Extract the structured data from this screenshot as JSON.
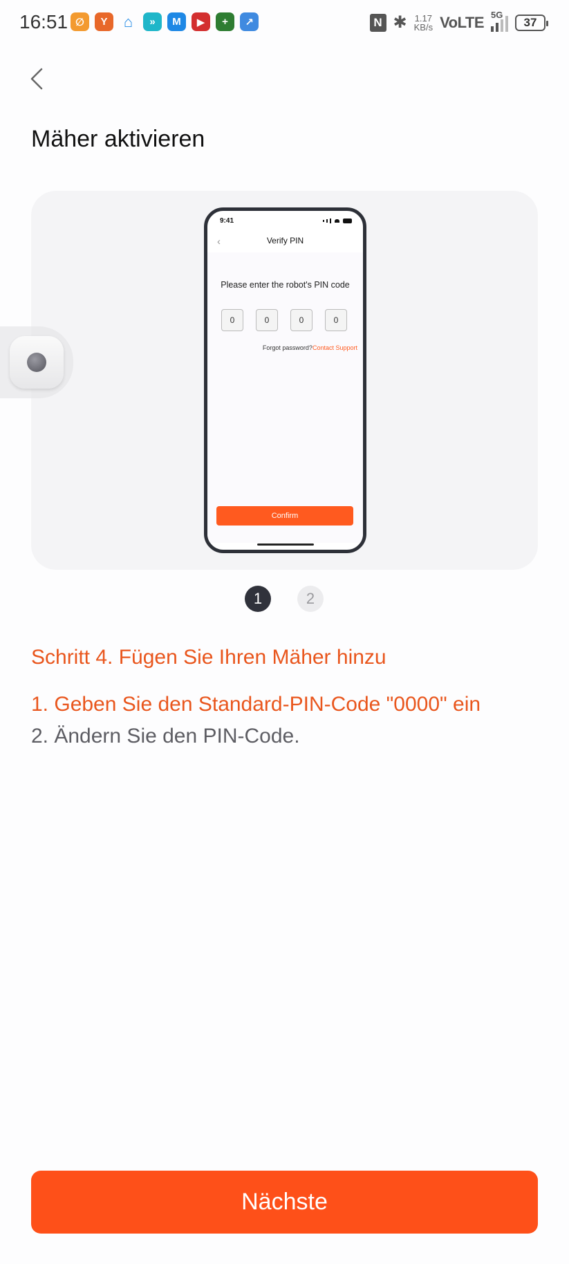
{
  "status_bar": {
    "time": "16:51",
    "speed_value": "1.17",
    "speed_unit": "KB/s",
    "network": "VoLTE",
    "generation": "5G",
    "battery": "37",
    "app_icons": [
      {
        "name": "app-icon-1",
        "color": "#f39a2f"
      },
      {
        "name": "app-icon-2",
        "color": "#e8682a"
      },
      {
        "name": "home-icon",
        "color": "#1e88e5"
      },
      {
        "name": "app-icon-4",
        "color": "#1fb6c9"
      },
      {
        "name": "app-icon-5",
        "color": "#1e88e5"
      },
      {
        "name": "app-icon-6",
        "color": "#d32f2f"
      },
      {
        "name": "app-icon-7",
        "color": "#2e7d32"
      },
      {
        "name": "app-icon-8",
        "color": "#3f8ae0"
      }
    ]
  },
  "header": {
    "title": "Mäher aktivieren"
  },
  "illustration": {
    "phone_time": "9:41",
    "screen_title": "Verify PIN",
    "prompt": "Please enter the robot's PIN code",
    "pin_digits": [
      "0",
      "0",
      "0",
      "0"
    ],
    "forgot_text": "Forgot password?",
    "support_link": "Contact Support",
    "confirm_label": "Confirm"
  },
  "pager": {
    "pages": [
      "1",
      "2"
    ],
    "active": 1
  },
  "instructions": {
    "step_title": "Schritt 4. Fügen Sie Ihren Mäher hinzu",
    "line1": "1. Geben Sie den Standard-PIN-Code \"0000\" ein",
    "line2": "2. Ändern Sie den PIN-Code."
  },
  "footer": {
    "next_label": "Nächste"
  },
  "colors": {
    "accent": "#fe5019",
    "step_text": "#e9561d"
  }
}
